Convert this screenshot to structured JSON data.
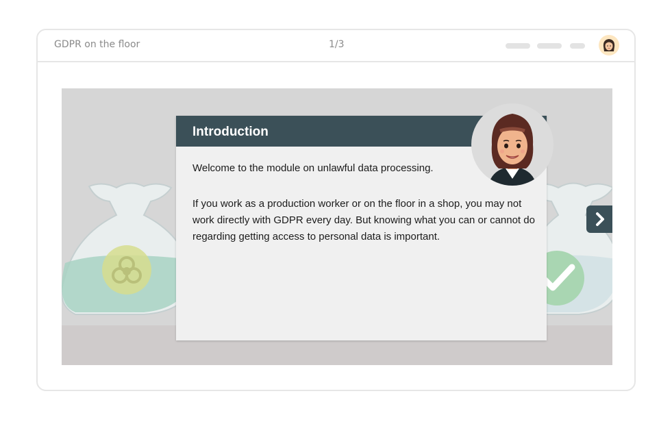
{
  "header": {
    "title": "GDPR on the floor",
    "counter": "1/3"
  },
  "card": {
    "title": "Introduction",
    "paragraph1": "Welcome to the module on unlawful data processing.",
    "paragraph2": "If you work as a production worker or on the floor in a shop, you may not work directly with GDPR every day. But knowing what you can or cannot do regarding getting access to personal data is important."
  },
  "icons": {
    "left_bag": "biohazard-icon",
    "right_bag": "checkmark-icon",
    "next": "chevron-right-icon",
    "avatar": "user-avatar-icon",
    "portrait": "character-portrait"
  },
  "colors": {
    "header_bar": "#3b5058",
    "card_bg": "#f0f0f0",
    "stage_bg": "#d6d6d6"
  }
}
